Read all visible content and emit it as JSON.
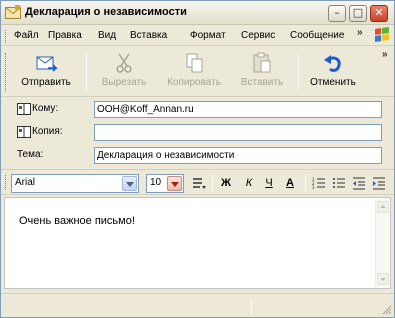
{
  "window": {
    "title": "Декларация о независимости",
    "minimize_glyph": "–",
    "maximize_glyph": "□",
    "close_glyph": "✕"
  },
  "menu": {
    "items": [
      "Файл",
      "Правка",
      "Вид",
      "Вставка",
      "Формат",
      "Сервис",
      "Сообщение"
    ],
    "overflow": "»"
  },
  "toolbar": {
    "send": "Отправить",
    "cut": "Вырезать",
    "copy": "Копировать",
    "paste": "Вставить",
    "undo": "Отменить",
    "overflow": "»"
  },
  "address": {
    "to_label": "Кому:",
    "to_value": "OOH@Koff_Annan.ru",
    "cc_label": "Копия:",
    "cc_value": "",
    "subject_label": "Тема:",
    "subject_value": "Декларация о независимости"
  },
  "format": {
    "font": "Arial",
    "size": "10",
    "bold": "Ж",
    "italic": "К",
    "underline": "Ч",
    "font_color": "А"
  },
  "message": {
    "text": "Очень важное письмо!"
  },
  "colors": {
    "accent": "#1c5bd6",
    "close_button": "#c4442a",
    "chrome": "#ece9d8"
  }
}
